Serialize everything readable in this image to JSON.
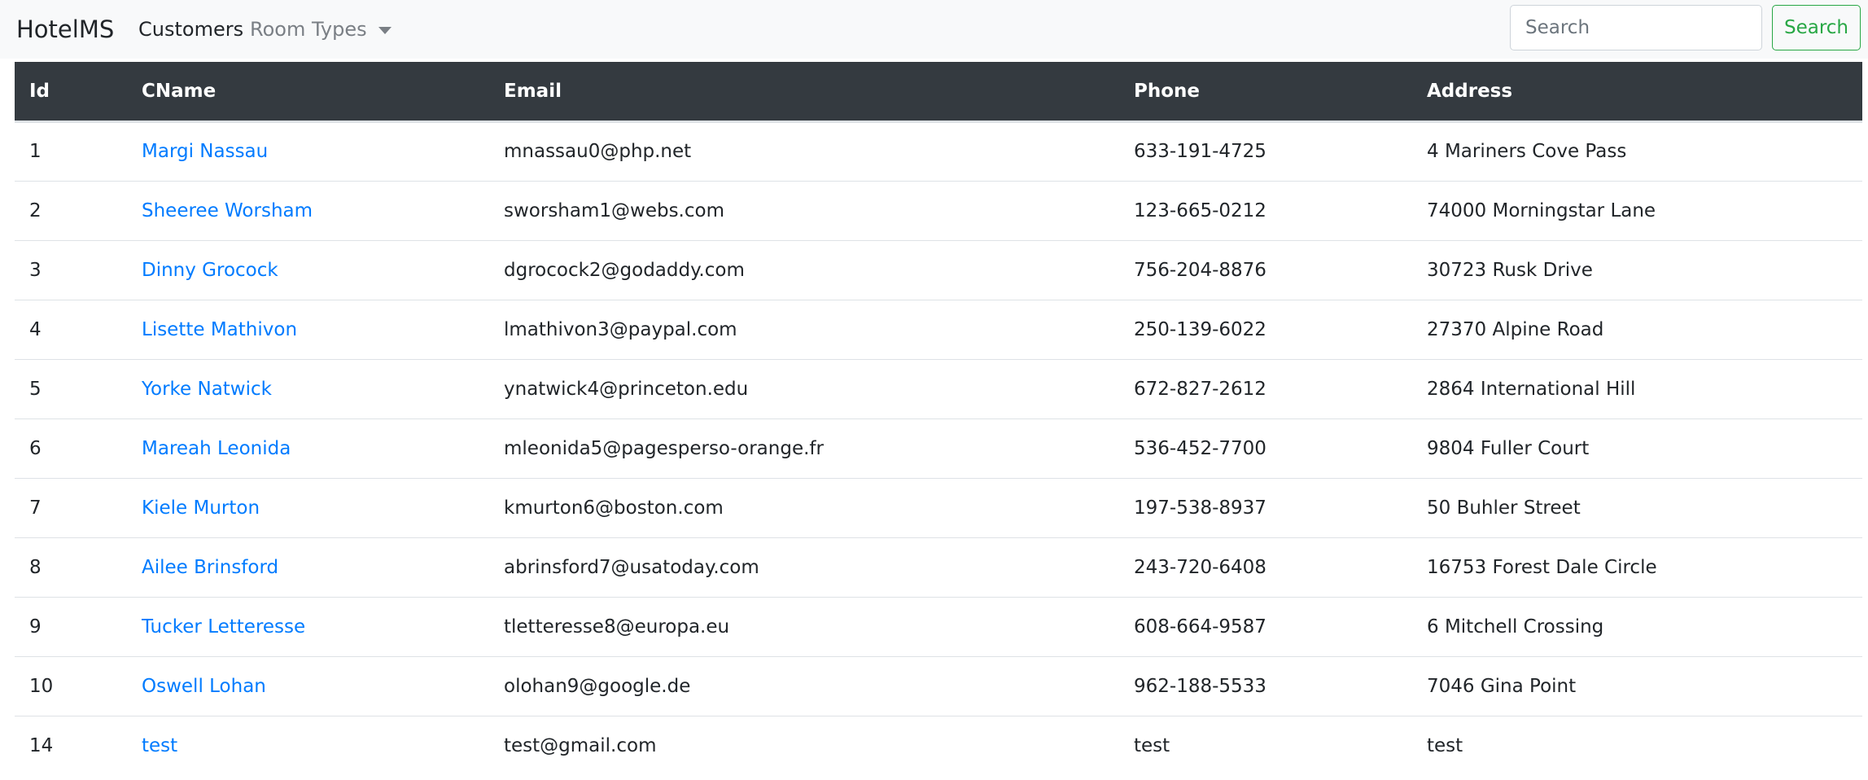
{
  "navbar": {
    "brand": "HotelMS",
    "links": [
      {
        "label": "Customers"
      },
      {
        "label": "Room Types"
      }
    ],
    "search": {
      "placeholder": "Search",
      "value": "",
      "button_label": "Search"
    }
  },
  "colors": {
    "navbar_bg": "#f8f9fa",
    "table_header_bg": "#343a40",
    "link": "#007bff",
    "success": "#28a745"
  },
  "table": {
    "headers": [
      "Id",
      "CName",
      "Email",
      "Phone",
      "Address"
    ],
    "rows": [
      {
        "id": "1",
        "name": "Margi Nassau",
        "email": "mnassau0@php.net",
        "phone": "633-191-4725",
        "address": "4 Mariners Cove Pass"
      },
      {
        "id": "2",
        "name": "Sheeree Worsham",
        "email": "sworsham1@webs.com",
        "phone": "123-665-0212",
        "address": "74000 Morningstar Lane"
      },
      {
        "id": "3",
        "name": "Dinny Grocock",
        "email": "dgrocock2@godaddy.com",
        "phone": "756-204-8876",
        "address": "30723 Rusk Drive"
      },
      {
        "id": "4",
        "name": "Lisette Mathivon",
        "email": "lmathivon3@paypal.com",
        "phone": "250-139-6022",
        "address": "27370 Alpine Road"
      },
      {
        "id": "5",
        "name": "Yorke Natwick",
        "email": "ynatwick4@princeton.edu",
        "phone": "672-827-2612",
        "address": "2864 International Hill"
      },
      {
        "id": "6",
        "name": "Mareah Leonida",
        "email": "mleonida5@pagesperso-orange.fr",
        "phone": "536-452-7700",
        "address": "9804 Fuller Court"
      },
      {
        "id": "7",
        "name": "Kiele Murton",
        "email": "kmurton6@boston.com",
        "phone": "197-538-8937",
        "address": "50 Buhler Street"
      },
      {
        "id": "8",
        "name": "Ailee Brinsford",
        "email": "abrinsford7@usatoday.com",
        "phone": "243-720-6408",
        "address": "16753 Forest Dale Circle"
      },
      {
        "id": "9",
        "name": "Tucker Letteresse",
        "email": "tletteresse8@europa.eu",
        "phone": "608-664-9587",
        "address": "6 Mitchell Crossing"
      },
      {
        "id": "10",
        "name": "Oswell Lohan",
        "email": "olohan9@google.de",
        "phone": "962-188-5533",
        "address": "7046 Gina Point"
      },
      {
        "id": "14",
        "name": "test",
        "email": "test@gmail.com",
        "phone": "test",
        "address": "test"
      }
    ]
  }
}
